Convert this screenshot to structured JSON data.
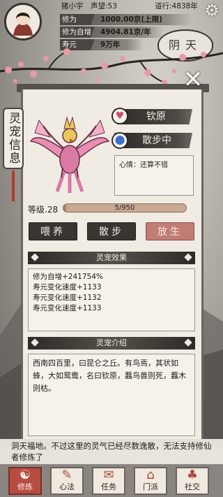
{
  "player": {
    "name": "猪小宇",
    "reputation": "声望:53",
    "dao_points": "道行:4838年",
    "stats": [
      {
        "label": "修为",
        "value": "1000.00京(上限)"
      },
      {
        "label": "修为自增",
        "value": "4904.81京/年"
      },
      {
        "label": "寿元",
        "value": "9万年"
      }
    ]
  },
  "weather": "阴天",
  "side_tab": "灵宠信息",
  "pet": {
    "name": "钦原",
    "status": "散步中",
    "mood": "心情：还算不错",
    "level_label": "等级.28",
    "exp_text": "5/950",
    "exp_progress": 0.005
  },
  "actions": {
    "feed": "喂养",
    "walk": "散步",
    "release": "放生"
  },
  "effects": {
    "title": "灵宠效果",
    "lines": [
      "修为自增+241754%",
      "寿元变化速度+1133",
      "寿元变化速度+1132",
      "寿元变化速度+1133"
    ]
  },
  "intro": {
    "title": "灵宠介绍",
    "text": "西南四百里，曰昆仑之丘。有鸟焉，其状如蜂，大如鸳鸯，名曰钦原，蠚鸟兽则死，蠚木则枯。"
  },
  "message": "洞天福地。不过这里的灵气已经尽数逸散，无法支持修仙者修炼了",
  "nav": [
    {
      "label": "修炼",
      "icon": "cultivate-icon"
    },
    {
      "label": "心法",
      "icon": "mind-method-icon"
    },
    {
      "label": "任务",
      "icon": "task-icon"
    },
    {
      "label": "门派",
      "icon": "sect-icon"
    },
    {
      "label": "社交",
      "icon": "social-icon"
    }
  ]
}
